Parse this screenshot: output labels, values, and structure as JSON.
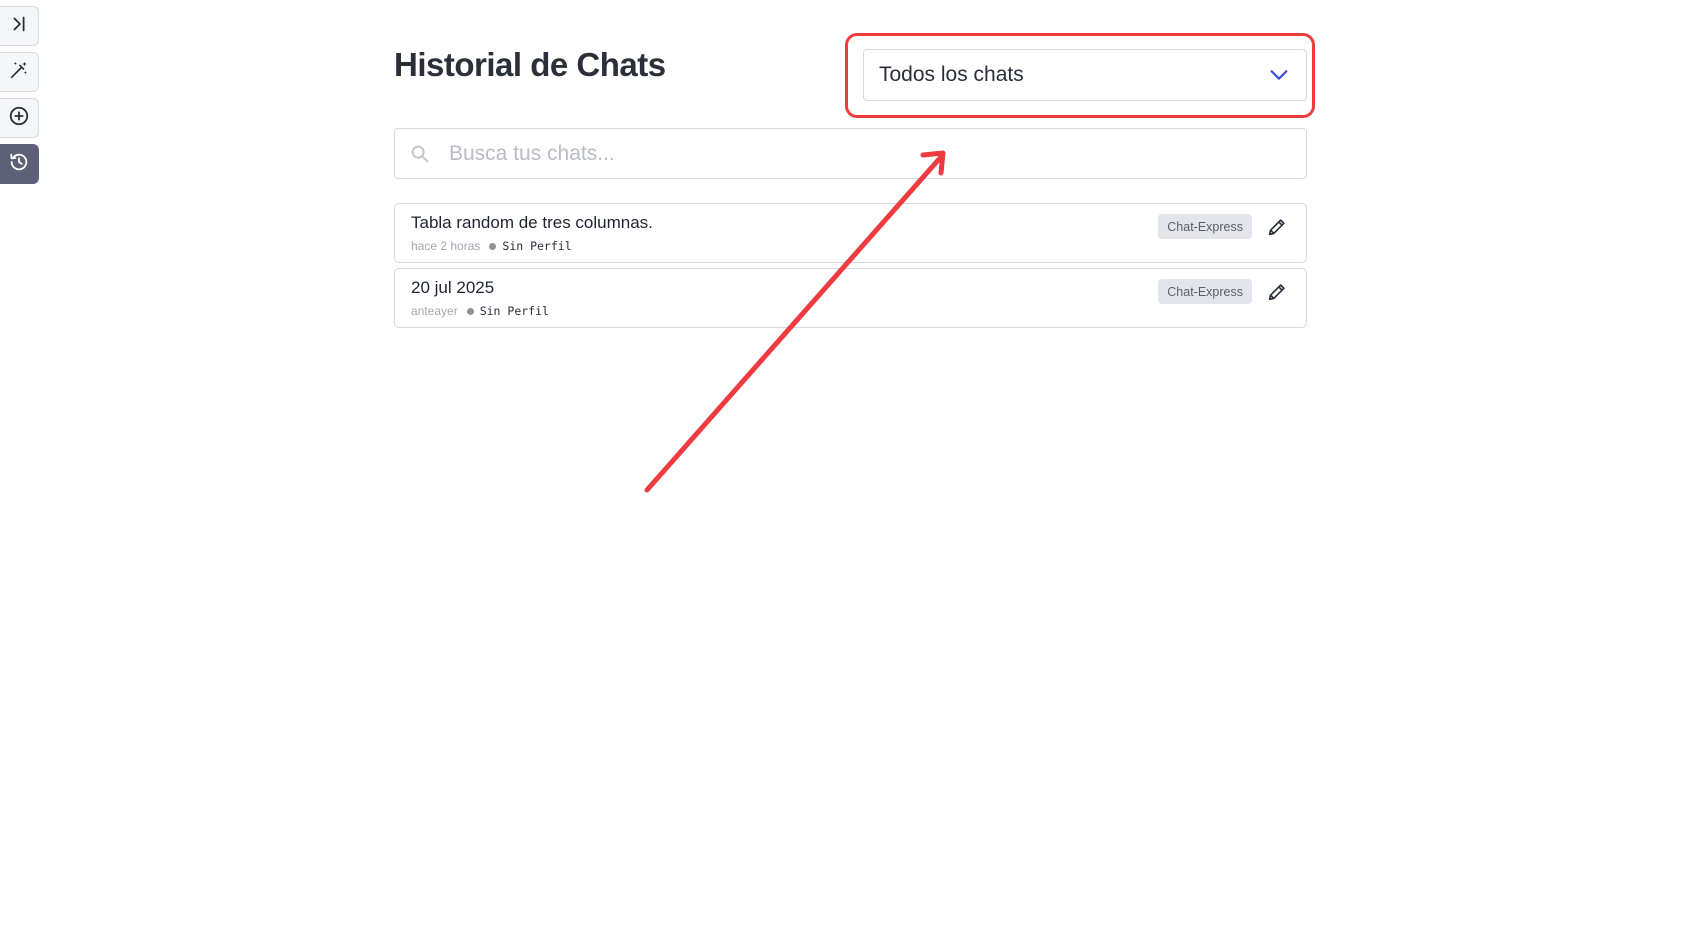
{
  "rail": {
    "items": [
      {
        "icon": "expand-sidebar-icon"
      },
      {
        "icon": "magic-wand-icon"
      },
      {
        "icon": "plus-circle-icon"
      },
      {
        "icon": "history-icon",
        "active": true
      }
    ]
  },
  "header": {
    "title": "Historial de Chats"
  },
  "filter": {
    "selected": "Todos los chats"
  },
  "search": {
    "placeholder": "Busca tus chats..."
  },
  "chats": [
    {
      "title": "Tabla random de tres columnas.",
      "time": "hace 2 horas",
      "profile": "Sin Perfil",
      "tag": "Chat-Express"
    },
    {
      "title": "20 jul 2025",
      "time": "anteayer",
      "profile": "Sin Perfil",
      "tag": "Chat-Express"
    }
  ],
  "colors": {
    "highlight": "#ee3b3f",
    "chevron": "#3b4fd6",
    "active_rail": "#5e6078"
  }
}
